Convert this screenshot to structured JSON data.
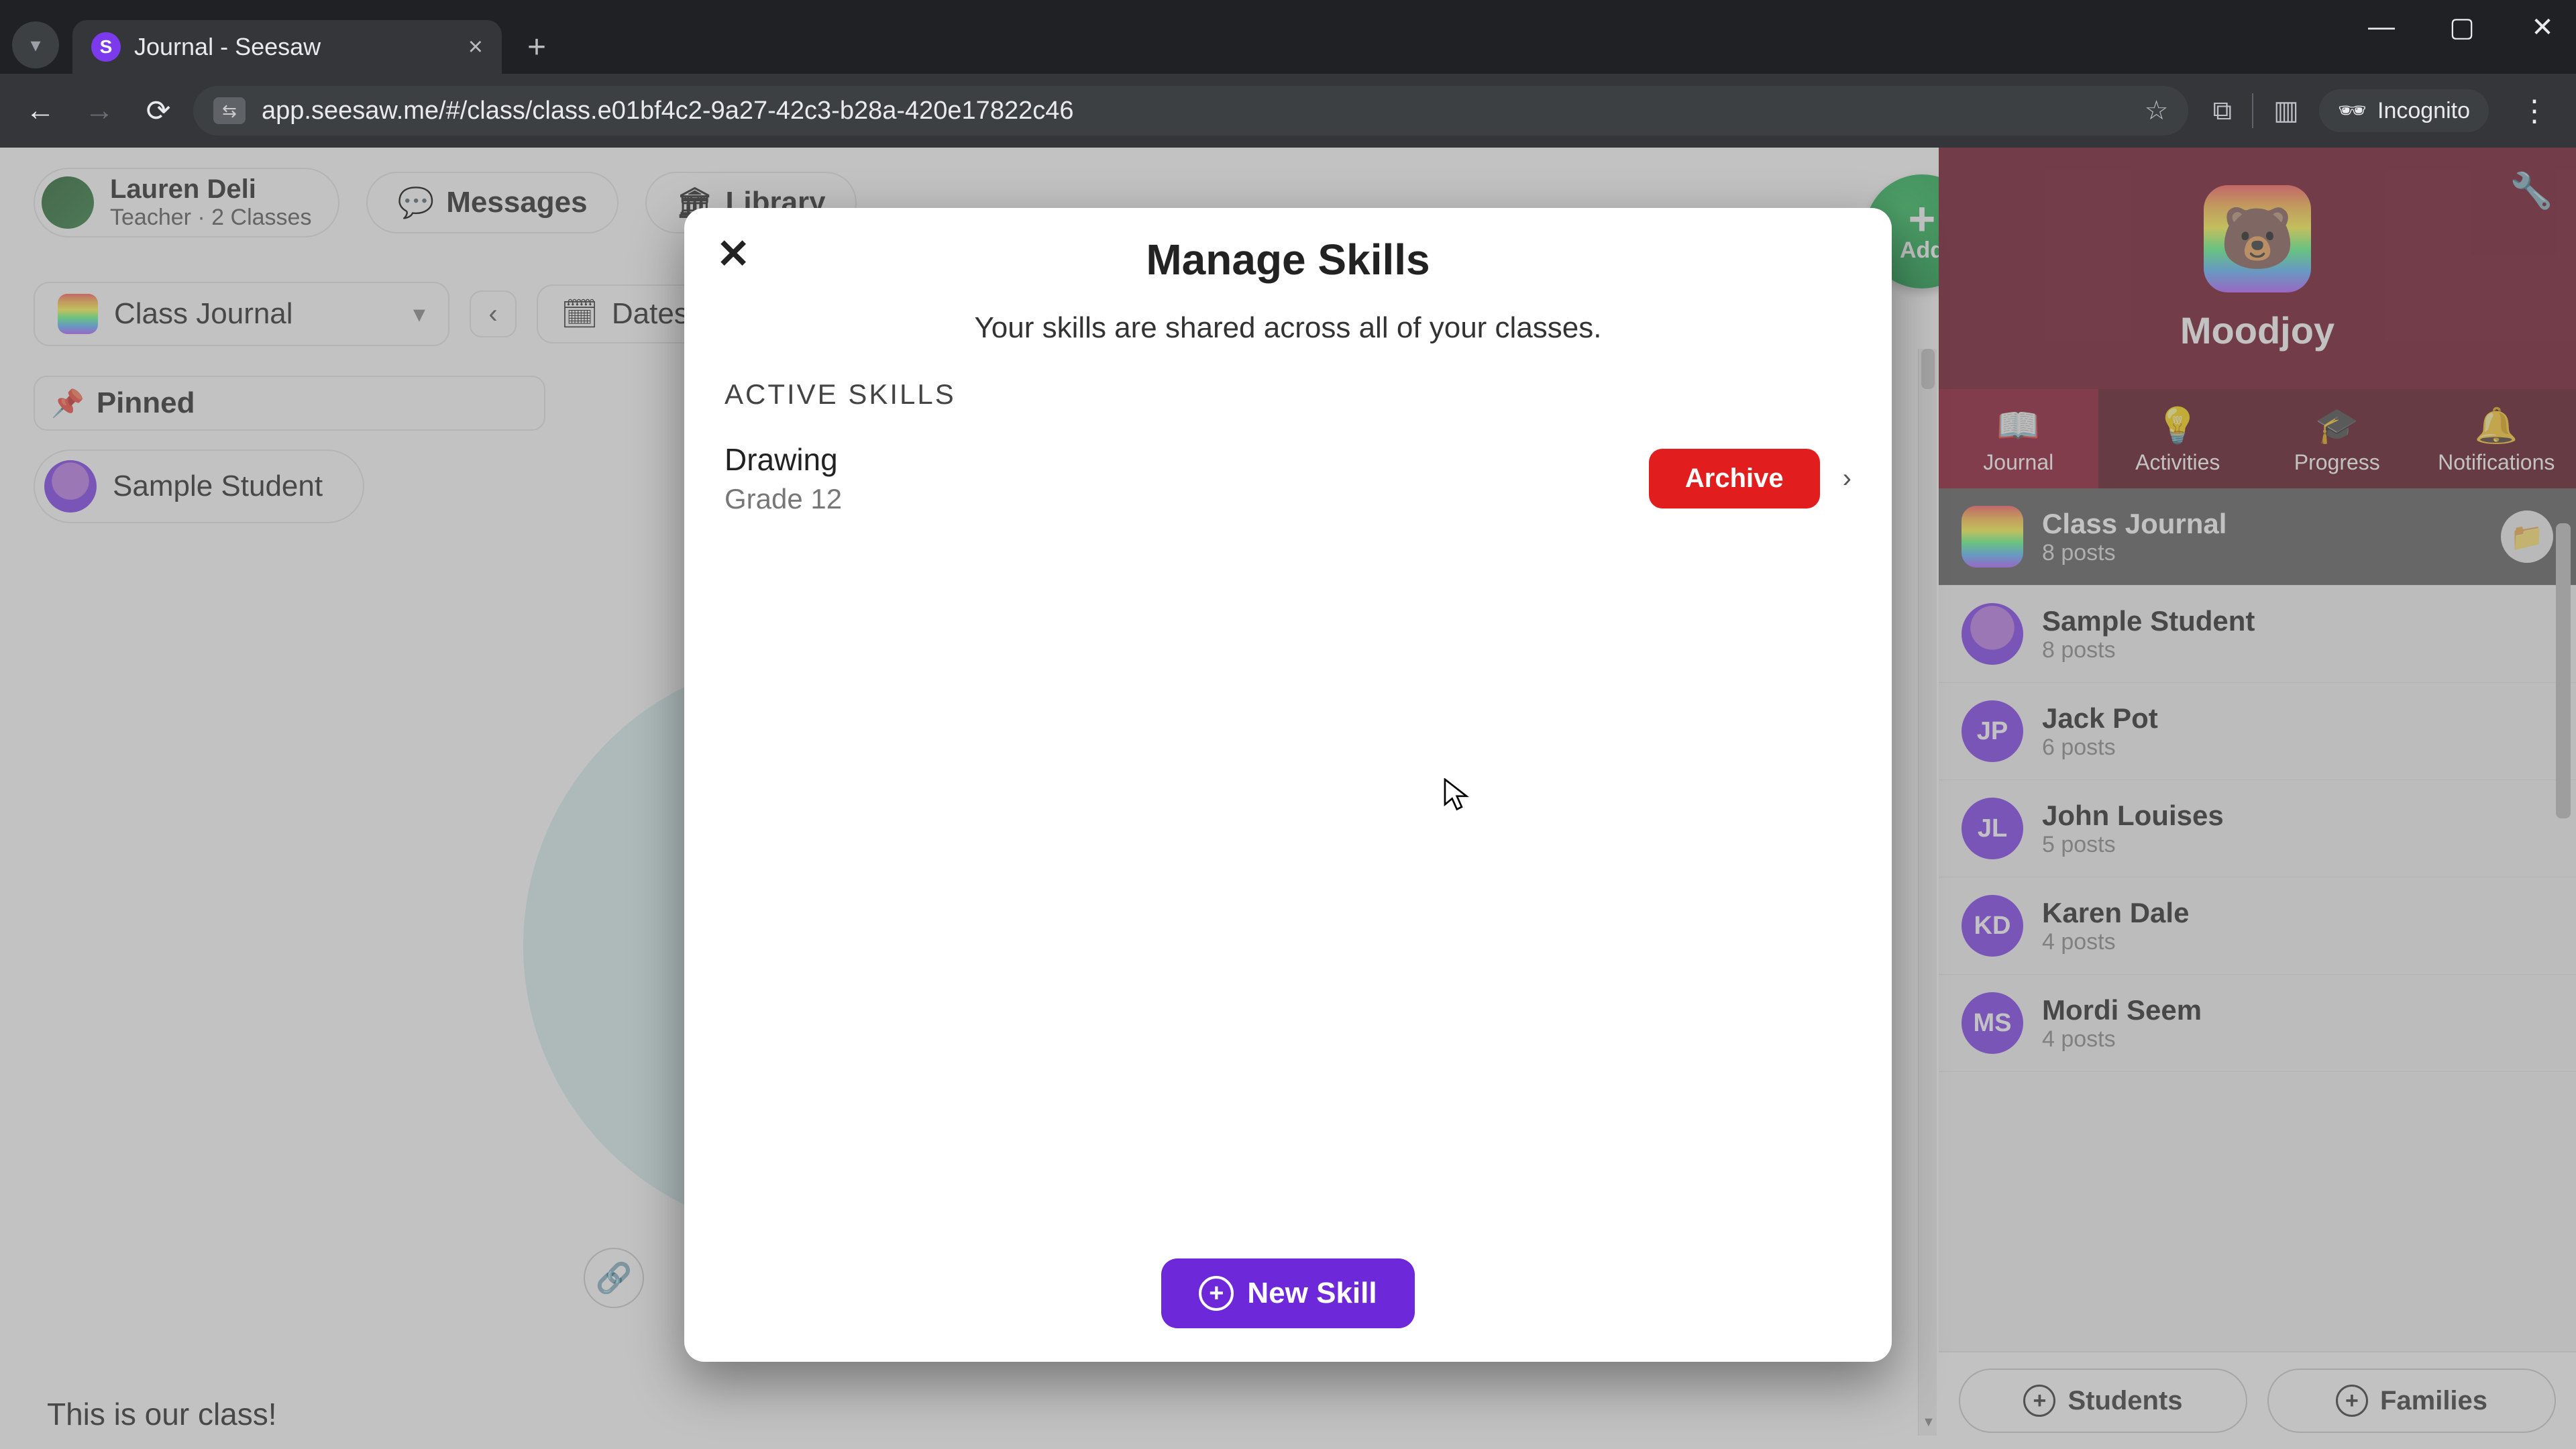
{
  "browser": {
    "tab_title": "Journal - Seesaw",
    "url": "app.seesaw.me/#/class/class.e01bf4c2-9a27-42c3-b28a-420e17822c46",
    "incognito_label": "Incognito"
  },
  "header": {
    "user_name": "Lauren Deli",
    "user_sub": "Teacher · 2 Classes",
    "messages_label": "Messages",
    "library_label": "Library"
  },
  "subheader": {
    "journal_dd": "Class Journal",
    "dates_label": "Dates"
  },
  "pinned_label": "Pinned",
  "sample_student": "Sample Student",
  "add_label": "Add",
  "caption": "This is our class!",
  "right": {
    "class_name": "Moodjoy",
    "tabs": {
      "journal": "Journal",
      "activities": "Activities",
      "progress": "Progress",
      "notifications": "Notifications"
    },
    "items": [
      {
        "title": "Class Journal",
        "sub": "8 posts",
        "initials": "",
        "kind": "class",
        "selected": true
      },
      {
        "title": "Sample Student",
        "sub": "8 posts",
        "initials": "",
        "kind": "anon"
      },
      {
        "title": "Jack Pot",
        "sub": "6 posts",
        "initials": "JP",
        "kind": "person"
      },
      {
        "title": "John Louises",
        "sub": "5 posts",
        "initials": "JL",
        "kind": "person"
      },
      {
        "title": "Karen Dale",
        "sub": "4 posts",
        "initials": "KD",
        "kind": "person"
      },
      {
        "title": "Mordi Seem",
        "sub": "4 posts",
        "initials": "MS",
        "kind": "person"
      }
    ],
    "footer": {
      "students": "Students",
      "families": "Families"
    }
  },
  "modal": {
    "title": "Manage Skills",
    "subtitle": "Your skills are shared across all of your classes.",
    "section": "ACTIVE SKILLS",
    "skill": {
      "name": "Drawing",
      "grade": "Grade 12"
    },
    "archive": "Archive",
    "new_skill": "New Skill"
  }
}
